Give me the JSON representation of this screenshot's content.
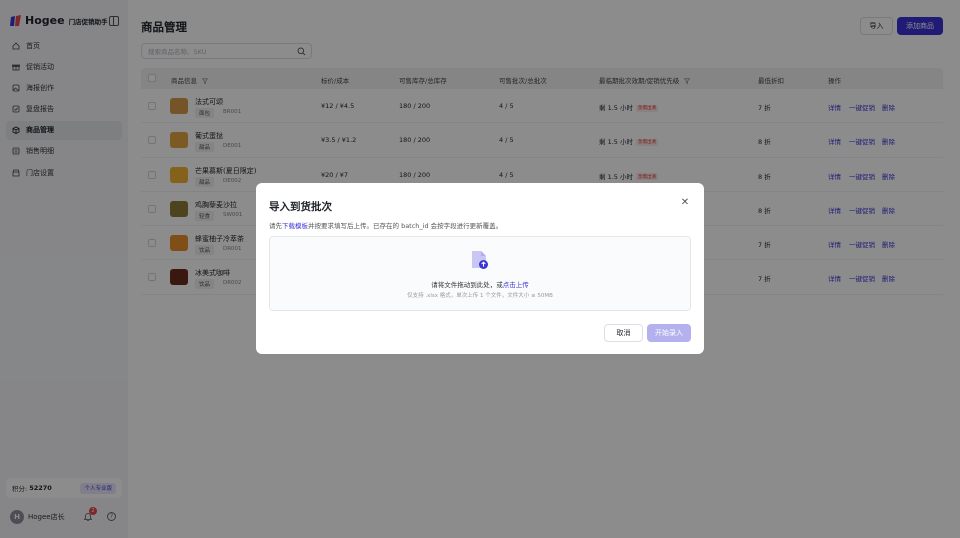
{
  "colors": {
    "accent": "#3b34d6",
    "danger": "#e5484d",
    "disabled_primary": "#b5b1ef"
  },
  "brand": {
    "name": "Hogee",
    "subtitle": "门店促销助手"
  },
  "sidebar": {
    "items": [
      {
        "label": "首页",
        "icon": "home-icon"
      },
      {
        "label": "促销活动",
        "icon": "gift-icon"
      },
      {
        "label": "海报创作",
        "icon": "image-icon"
      },
      {
        "label": "复盘报告",
        "icon": "report-icon"
      },
      {
        "label": "商品管理",
        "icon": "box-icon",
        "active": true
      },
      {
        "label": "销售明细",
        "icon": "list-icon"
      },
      {
        "label": "门店设置",
        "icon": "store-icon"
      }
    ],
    "points_label": "积分:",
    "points_value": "52270",
    "plan_badge": "个人专业版",
    "user_initial": "H",
    "user_name": "Hogee店长",
    "notification_count": "2"
  },
  "page": {
    "title": "商品管理",
    "import_label": "导入",
    "add_label": "添加商品",
    "search_placeholder": "搜索商品名称、SKU"
  },
  "table": {
    "headers": [
      "商品信息",
      "标价/成本",
      "可售库存/总库存",
      "可售批次/总批次",
      "最临期批次效期/促销优先级",
      "最低折扣",
      "操作"
    ],
    "rows": [
      {
        "name": "法式可颂",
        "category": "面包",
        "sku": "BR001",
        "price": "¥12 / ¥4.5",
        "stock": "180 / 200",
        "batches": "4 / 5",
        "expiry": "剩 1.5 小时",
        "tag": "急需出清",
        "discount": "7 折",
        "thumb": "#d69a4a"
      },
      {
        "name": "葡式蛋挞",
        "category": "甜品",
        "sku": "DE001",
        "price": "¥3.5 / ¥1.2",
        "stock": "180 / 200",
        "batches": "4 / 5",
        "expiry": "剩 1.5 小时",
        "tag": "急需出清",
        "discount": "8 折",
        "thumb": "#e0a640"
      },
      {
        "name": "芒果慕斯(夏日限定)",
        "category": "甜品",
        "sku": "DE002",
        "price": "¥20 / ¥7",
        "stock": "180 / 200",
        "batches": "4 / 5",
        "expiry": "剩 1.5 小时",
        "tag": "急需出清",
        "discount": "8 折",
        "thumb": "#f2b233"
      },
      {
        "name": "鸡胸藜麦沙拉",
        "category": "轻食",
        "sku": "SW001",
        "price": "",
        "stock": "",
        "batches": "",
        "expiry": "",
        "tag": "",
        "discount": "8 折",
        "thumb": "#8c7a3a"
      },
      {
        "name": "蜂蜜柚子冷萃茶",
        "category": "饮品",
        "sku": "DR001",
        "price": "",
        "stock": "",
        "batches": "",
        "expiry": "",
        "tag": "",
        "discount": "7 折",
        "thumb": "#e8902a"
      },
      {
        "name": "冰美式咖啡",
        "category": "饮品",
        "sku": "DR002",
        "price": "",
        "stock": "",
        "batches": "",
        "expiry": "",
        "tag": "",
        "discount": "7 折",
        "thumb": "#6b2c1c"
      }
    ],
    "ops": [
      "详情",
      "一键促销",
      "删除"
    ]
  },
  "modal": {
    "title": "导入到货批次",
    "desc_prefix": "请先",
    "desc_link": "下载模板",
    "desc_suffix": "并按要求填写后上传。已存在的 batch_id 会按字段进行更新覆盖。",
    "drop_main": "请将文件拖动到此处，或",
    "drop_link": "点击上传",
    "drop_hint": "仅支持 .xlsx 格式，单次上传 1 个文件，文件大小 ≤ 50MB",
    "cancel_label": "取消",
    "start_label": "开始录入"
  }
}
